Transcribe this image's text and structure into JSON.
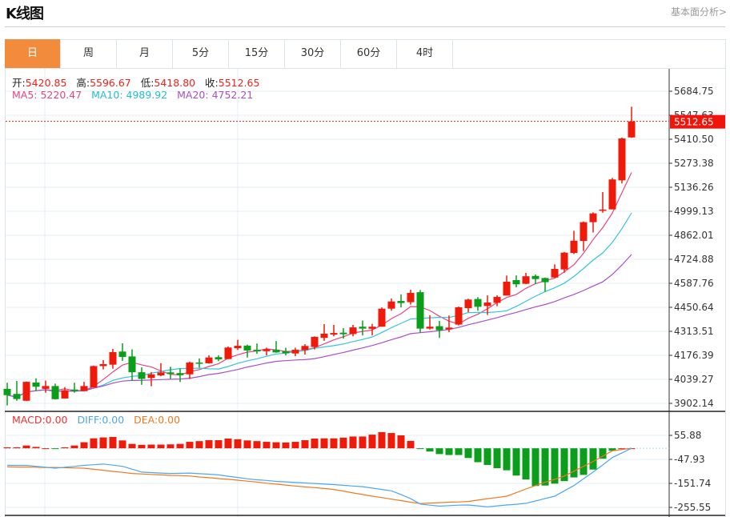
{
  "header": {
    "title": "K线图",
    "link": "基本面分析>"
  },
  "tabs": [
    {
      "label": "日",
      "active": true
    },
    {
      "label": "周"
    },
    {
      "label": "月"
    },
    {
      "label": "5分"
    },
    {
      "label": "15分"
    },
    {
      "label": "30分"
    },
    {
      "label": "60分"
    },
    {
      "label": "4时"
    }
  ],
  "ohlc_info": {
    "open_label": "开:",
    "open": "5420.85",
    "high_label": "高:",
    "high": "5596.67",
    "low_label": "低:",
    "low": "5418.80",
    "close_label": "收:",
    "close": "5512.65"
  },
  "ma_info": {
    "ma5": "MA5: 5220.47",
    "ma10": "MA10: 4989.92",
    "ma20": "MA20: 4752.21"
  },
  "macd_info": {
    "macd": "MACD:0.00",
    "diff": "DIFF:0.00",
    "dea": "DEA:0.00"
  },
  "colors": {
    "up": "#f01a0a",
    "down": "#0a9e1a",
    "ma5": "#e8457f",
    "ma10": "#33c5da",
    "ma20": "#a94fc8",
    "diff": "#4da6f0",
    "dea": "#f07820",
    "active_tab": "#f28c3c"
  },
  "chart_data": [
    {
      "type": "candlestick",
      "y_ticks": [
        "5684.75",
        "5547.63",
        "5410.50",
        "5273.38",
        "5136.26",
        "4999.13",
        "4862.01",
        "4724.88",
        "4587.76",
        "4450.64",
        "4313.51",
        "4176.39",
        "4039.27",
        "3902.14"
      ],
      "ylim": [
        3902.14,
        5684.75
      ],
      "last_price": "5512.65",
      "grid": true,
      "moving_averages": [
        5,
        10,
        20
      ],
      "candles_ohlc": [
        [
          3985,
          4020,
          3890,
          3949
        ],
        [
          3956,
          4030,
          3917,
          3927
        ],
        [
          3917,
          4027,
          3915,
          4025
        ],
        [
          4021,
          4045,
          3972,
          3997
        ],
        [
          3985,
          4032,
          3963,
          4001
        ],
        [
          4001,
          4015,
          3924,
          3926
        ],
        [
          3930,
          3995,
          3930,
          3977
        ],
        [
          3981,
          4020,
          3963,
          3972
        ],
        [
          3972,
          4025,
          3972,
          4001
        ],
        [
          3993,
          4118,
          3993,
          4115
        ],
        [
          4115,
          4149,
          4096,
          4126
        ],
        [
          4123,
          4213,
          4100,
          4195
        ],
        [
          4198,
          4245,
          4145,
          4167
        ],
        [
          4170,
          4211,
          4032,
          4080
        ],
        [
          4080,
          4108,
          4008,
          4042
        ],
        [
          4047,
          4080,
          4000,
          4068
        ],
        [
          4062,
          4132,
          4057,
          4079
        ],
        [
          4079,
          4111,
          4042,
          4070
        ],
        [
          4075,
          4100,
          4024,
          4063
        ],
        [
          4068,
          4141,
          4042,
          4135
        ],
        [
          4135,
          4159,
          4106,
          4129
        ],
        [
          4131,
          4177,
          4129,
          4164
        ],
        [
          4166,
          4177,
          4143,
          4153
        ],
        [
          4155,
          4227,
          4155,
          4221
        ],
        [
          4217,
          4265,
          4207,
          4231
        ],
        [
          4232,
          4237,
          4164,
          4204
        ],
        [
          4208,
          4244,
          4185,
          4199
        ],
        [
          4200,
          4220,
          4176,
          4211
        ],
        [
          4208,
          4258,
          4191,
          4193
        ],
        [
          4199,
          4220,
          4176,
          4188
        ],
        [
          4187,
          4220,
          4172,
          4208
        ],
        [
          4207,
          4240,
          4181,
          4230
        ],
        [
          4224,
          4285,
          4210,
          4282
        ],
        [
          4276,
          4355,
          4259,
          4300
        ],
        [
          4295,
          4350,
          4285,
          4304
        ],
        [
          4306,
          4332,
          4272,
          4297
        ],
        [
          4298,
          4350,
          4285,
          4336
        ],
        [
          4340,
          4375,
          4290,
          4329
        ],
        [
          4328,
          4356,
          4290,
          4340
        ],
        [
          4340,
          4450,
          4340,
          4443
        ],
        [
          4443,
          4501,
          4431,
          4484
        ],
        [
          4487,
          4525,
          4450,
          4475
        ],
        [
          4480,
          4551,
          4466,
          4533
        ],
        [
          4537,
          4550,
          4306,
          4329
        ],
        [
          4329,
          4405,
          4324,
          4340
        ],
        [
          4343,
          4373,
          4276,
          4320
        ],
        [
          4325,
          4404,
          4309,
          4335
        ],
        [
          4352,
          4455,
          4347,
          4451
        ],
        [
          4446,
          4500,
          4423,
          4495
        ],
        [
          4498,
          4509,
          4431,
          4454
        ],
        [
          4458,
          4519,
          4407,
          4478
        ],
        [
          4476,
          4519,
          4457,
          4510
        ],
        [
          4518,
          4632,
          4518,
          4597
        ],
        [
          4606,
          4633,
          4565,
          4582
        ],
        [
          4585,
          4647,
          4583,
          4628
        ],
        [
          4630,
          4638,
          4583,
          4612
        ],
        [
          4618,
          4621,
          4541,
          4594
        ],
        [
          4621,
          4696,
          4618,
          4670
        ],
        [
          4667,
          4767,
          4648,
          4763
        ],
        [
          4761,
          4888,
          4755,
          4831
        ],
        [
          4830,
          4941,
          4772,
          4937
        ],
        [
          4937,
          4993,
          4878,
          4987
        ],
        [
          5002,
          5109,
          4991,
          5009
        ],
        [
          5010,
          5190,
          5010,
          5181
        ],
        [
          5176,
          5420,
          5158,
          5415
        ],
        [
          5420.85,
          5596.67,
          5418.8,
          5512.65
        ]
      ]
    },
    {
      "type": "macd",
      "y_ticks": [
        "55.88",
        "-47.93",
        "-151.74",
        "-255.55"
      ],
      "ylim": [
        -255.55,
        55.88
      ],
      "histogram": [
        4,
        4,
        12,
        6,
        0,
        -2,
        4,
        12,
        26,
        43,
        47,
        49,
        34,
        19,
        15,
        16,
        16,
        17,
        19,
        28,
        31,
        35,
        35,
        42,
        39,
        34,
        31,
        28,
        26,
        25,
        28,
        35,
        42,
        43,
        43,
        46,
        51,
        51,
        59,
        70,
        66,
        56,
        32,
        -3,
        -14,
        -25,
        -29,
        -29,
        -42,
        -60,
        -72,
        -86,
        -95,
        -118,
        -135,
        -163,
        -161,
        -153,
        -142,
        -126,
        -115,
        -92,
        -45,
        -11,
        0,
        0
      ],
      "diff": [
        -74,
        -74,
        -74,
        -78,
        -82,
        -86,
        -82,
        -78,
        -74,
        -71,
        -68,
        -73,
        -78,
        -90,
        -103,
        -105,
        -107,
        -109,
        -108,
        -107,
        -110,
        -112,
        -115,
        -121,
        -126,
        -132,
        -136,
        -139,
        -143,
        -145,
        -148,
        -150,
        -152,
        -155,
        -157,
        -160,
        -163,
        -166,
        -172,
        -178,
        -184,
        -200,
        -218,
        -241,
        -246,
        -250,
        -248,
        -246,
        -245,
        -249,
        -253,
        -249,
        -245,
        -242,
        -238,
        -228,
        -217,
        -207,
        -184,
        -161,
        -132,
        -103,
        -72,
        -40,
        -20,
        0
      ],
      "dea": [
        -80,
        -81,
        -81,
        -82,
        -83,
        -83,
        -84,
        -85,
        -86,
        -91,
        -95,
        -100,
        -104,
        -109,
        -111,
        -113,
        -115,
        -117,
        -118,
        -120,
        -124,
        -127,
        -131,
        -134,
        -138,
        -142,
        -146,
        -151,
        -155,
        -159,
        -163,
        -167,
        -170,
        -174,
        -178,
        -185,
        -193,
        -200,
        -207,
        -213,
        -220,
        -226,
        -233,
        -239,
        -237,
        -235,
        -233,
        -232,
        -230,
        -224,
        -218,
        -213,
        -207,
        -192,
        -176,
        -161,
        -147,
        -134,
        -120,
        -99,
        -78,
        -57,
        -34,
        -11,
        -5,
        0
      ]
    }
  ]
}
